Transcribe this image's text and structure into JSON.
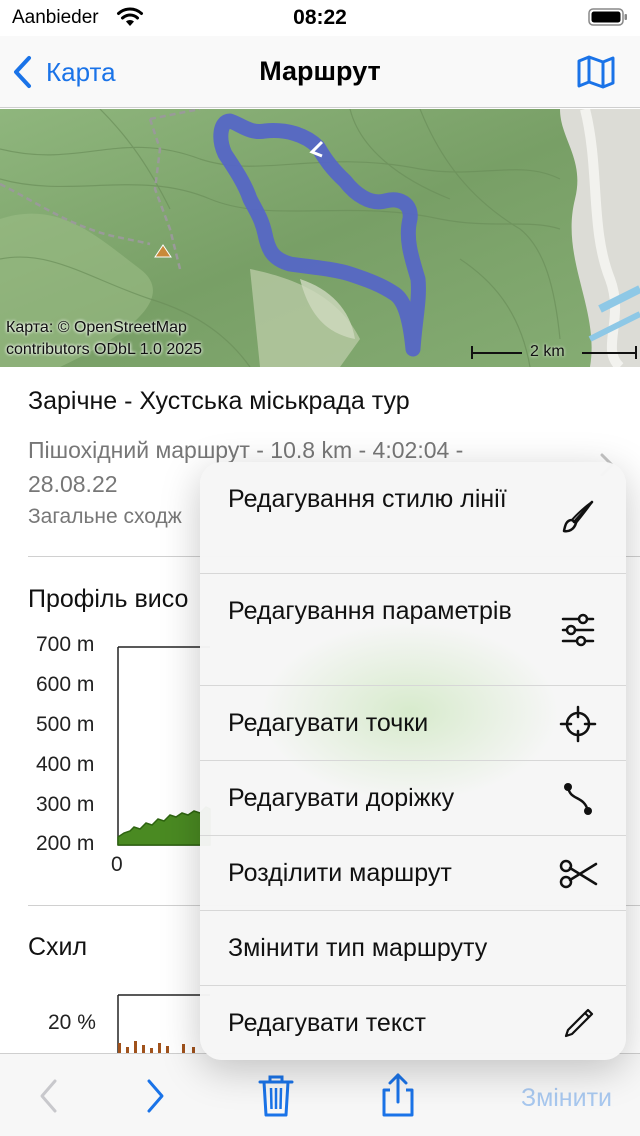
{
  "status": {
    "carrier": "Aanbieder",
    "time": "08:22"
  },
  "nav": {
    "back_label": "Карта",
    "title": "Маршрут"
  },
  "map": {
    "attribution_line1": "Карта: © OpenStreetMap",
    "attribution_line2": "contributors ODbL 1.0 2025",
    "scale_label": "2 km"
  },
  "route": {
    "name": "Зарічне - Хустська міськрада тур",
    "desc_line1": "Пішохідний маршрут - 10.8 km - 4:02:04 -",
    "desc_line2": "28.08.22",
    "desc_line3": "Загальне сходж"
  },
  "elevation": {
    "title": "Профіль висо",
    "yticks": [
      "700 m",
      "600 m",
      "500 m",
      "400 m",
      "300 m",
      "200 m"
    ],
    "x0": "0"
  },
  "slope": {
    "title": "Схил",
    "ytick": "20 %"
  },
  "menu": {
    "items": [
      {
        "label": "Редагування стилю лінії",
        "icon": "brush-icon"
      },
      {
        "label": "Редагування параметрів",
        "icon": "sliders-icon"
      },
      {
        "label": "Редагувати точки",
        "icon": "crosshair-icon"
      },
      {
        "label": "Редагувати доріжку",
        "icon": "path-icon"
      },
      {
        "label": "Розділити маршрут",
        "icon": "scissors-icon"
      },
      {
        "label": "Змінити тип маршруту",
        "icon": ""
      },
      {
        "label": "Редагувати текст",
        "icon": "pencil-icon"
      }
    ]
  },
  "toolbar": {
    "edit_label": "Змінити"
  },
  "colors": {
    "accent": "#1a73e8",
    "route": "#5565c8",
    "elevation_fill": "#4a8a22",
    "disabled": "#a8c8ef"
  }
}
